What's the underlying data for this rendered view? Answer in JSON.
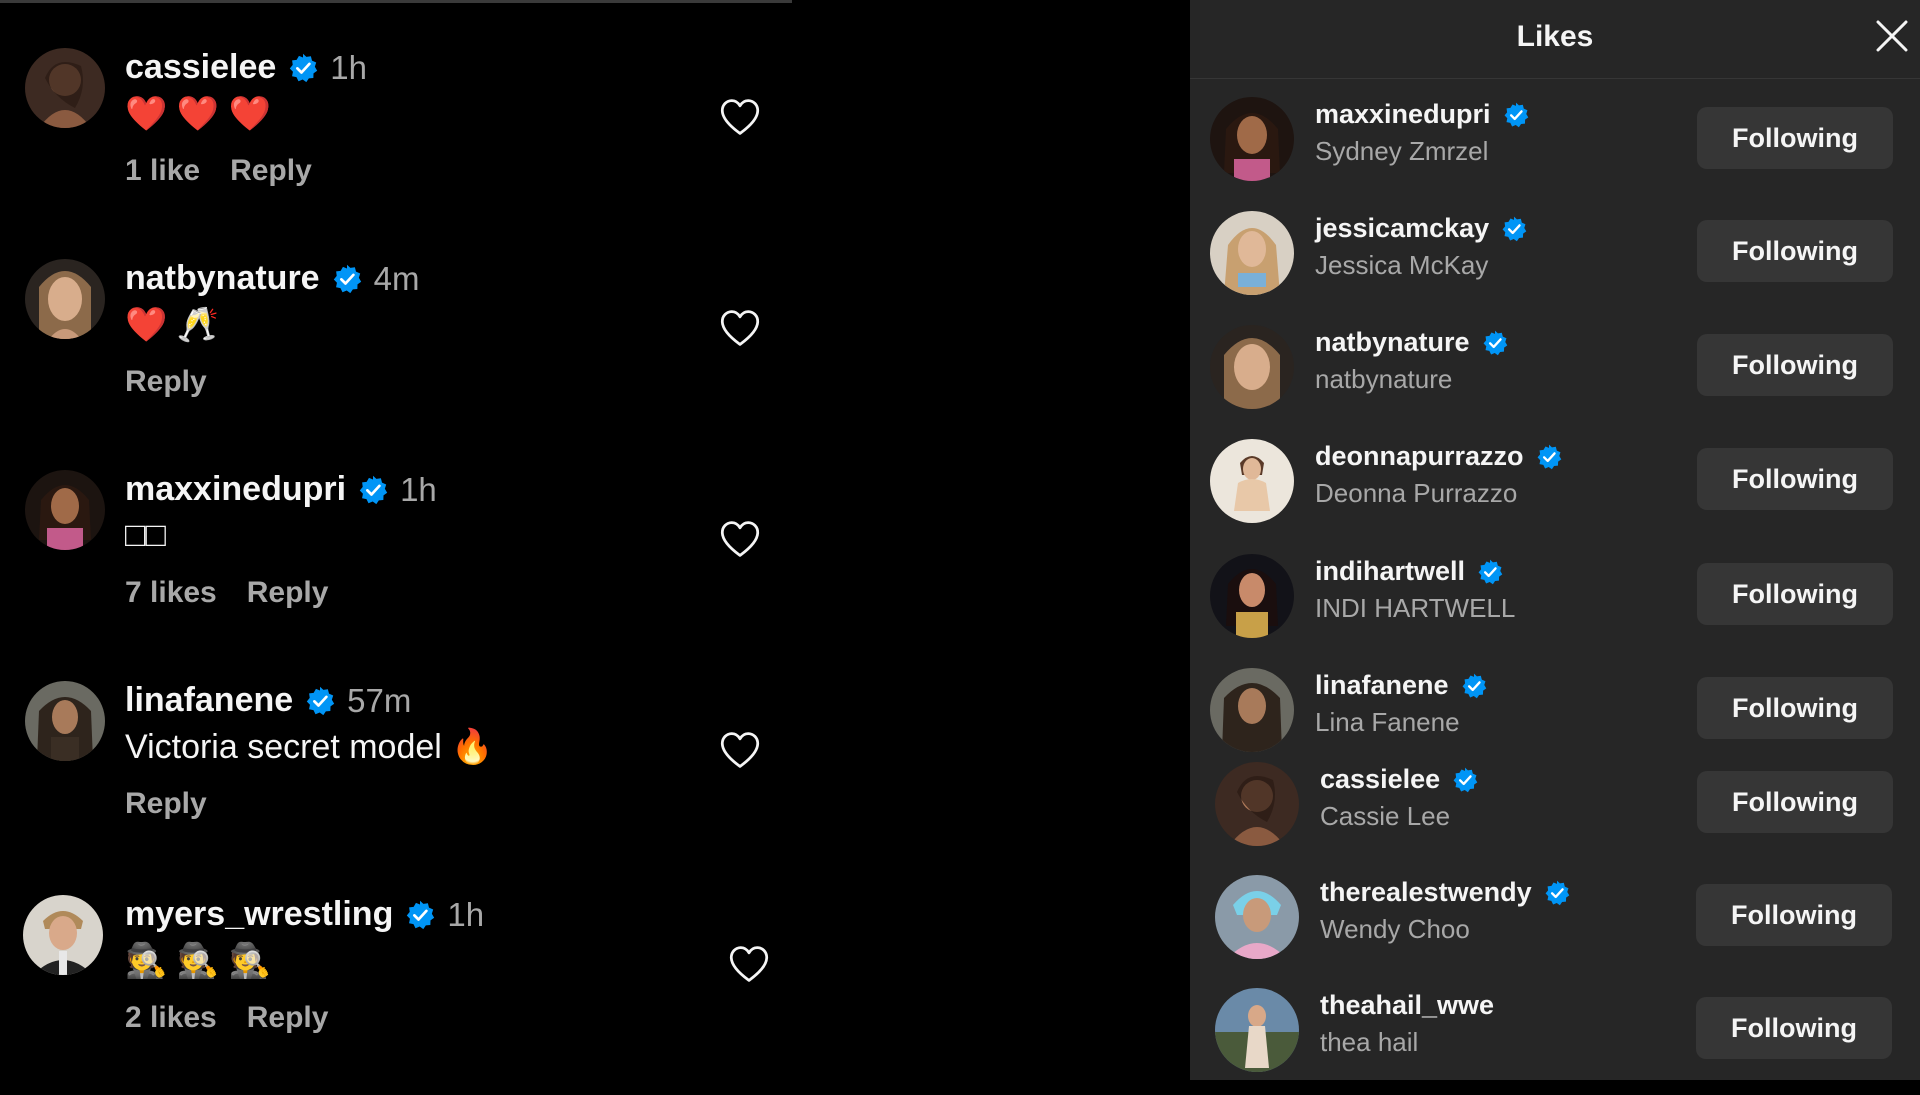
{
  "comments": [
    {
      "username": "cassielee",
      "time": "1h",
      "text": "❤️ ❤️ ❤️",
      "meta": [
        "1 like",
        "Reply"
      ]
    },
    {
      "username": "natbynature",
      "time": "4m",
      "text": "❤️ 🥂",
      "meta": [
        "Reply"
      ]
    },
    {
      "username": "maxxinedupri",
      "time": "1h",
      "text": "□□",
      "meta": [
        "7 likes",
        "Reply"
      ]
    },
    {
      "username": "linafanene",
      "time": "57m",
      "text": "Victoria secret model 🔥",
      "meta": [
        "Reply"
      ]
    },
    {
      "username": "myers_wrestling",
      "time": "1h",
      "text": "🕵️ 🕵️ 🕵️",
      "meta": [
        "2 likes",
        "Reply"
      ]
    }
  ],
  "likes_panel": {
    "title": "Likes",
    "close_icon": "close-icon",
    "items": [
      {
        "username": "maxxinedupri",
        "name": "Sydney Zmrzel",
        "button": "Following"
      },
      {
        "username": "jessicamckay",
        "name": "Jessica McKay",
        "button": "Following"
      },
      {
        "username": "natbynature",
        "name": "natbynature",
        "button": "Following"
      },
      {
        "username": "deonnapurrazzo",
        "name": "Deonna Purrazzo",
        "button": "Following"
      },
      {
        "username": "indihartwell",
        "name": "INDI HARTWELL",
        "button": "Following"
      },
      {
        "username": "linafanene",
        "name": "Lina Fanene",
        "button": "Following"
      },
      {
        "username": "cassielee",
        "name": "Cassie Lee",
        "button": "Following"
      },
      {
        "username": "therealestwendy",
        "name": "Wendy Choo",
        "button": "Following"
      },
      {
        "username": "theahail_wwe",
        "name": "thea hail",
        "button": "Following"
      }
    ]
  },
  "colors": {
    "verified": "#0095f6",
    "panel_bg": "#262626",
    "button_bg": "#363636",
    "secondary_text": "#a8a8a8"
  },
  "icons": {
    "heart": "heart-outline-icon",
    "verified": "verified-badge-icon"
  }
}
